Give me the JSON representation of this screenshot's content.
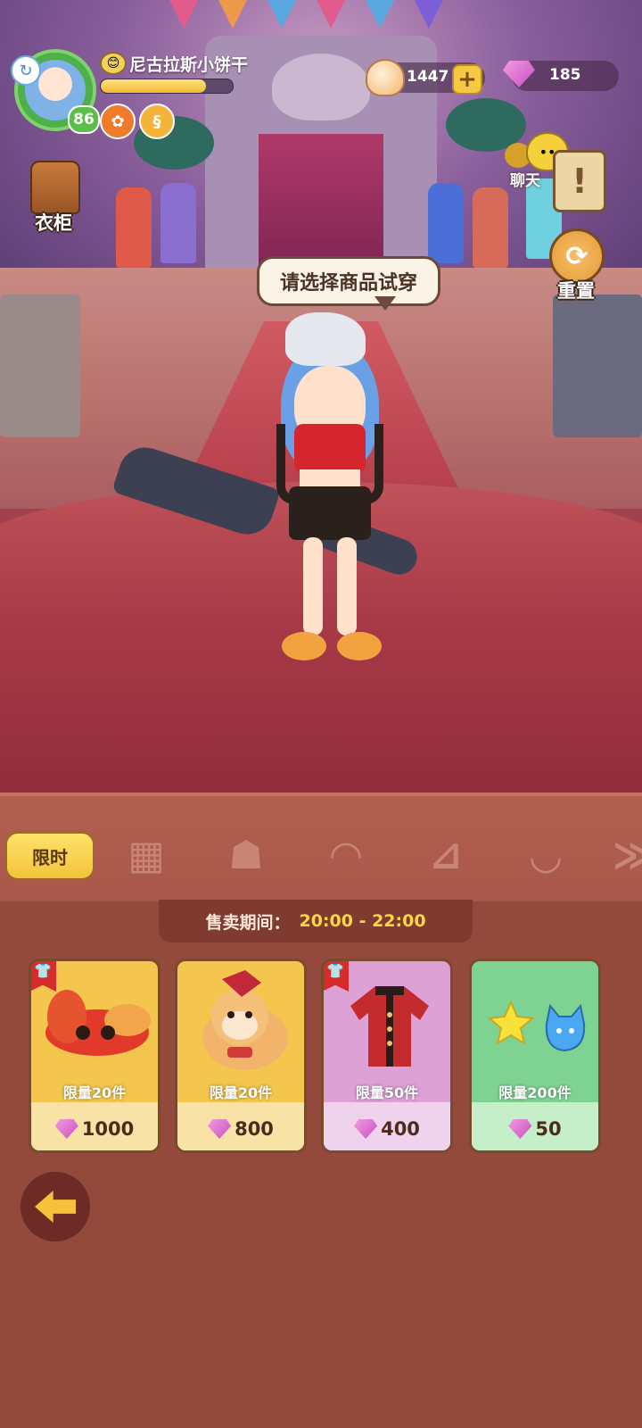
{
  "hud": {
    "player_name": "尼古拉斯小饼干",
    "level": "86",
    "exp_fraction": 0.8,
    "shells": "1447",
    "gems": "185"
  },
  "scene": {
    "prompt_bubble": "请选择商品试穿"
  },
  "side_buttons": {
    "wardrobe": "衣柜",
    "chat": "聊天",
    "reset": "重置"
  },
  "tabs": {
    "active_label": "限时",
    "icons": [
      "grid-icon",
      "face-icon",
      "hair-icon",
      "outfit-icon",
      "ears-icon",
      "more-icon"
    ]
  },
  "sale": {
    "label": "售卖期间：",
    "time": "20:00 - 22:00"
  },
  "items": [
    {
      "limit": "限量20件",
      "price": "1000",
      "tier": "gold",
      "tag": true,
      "icon": "mask-icon"
    },
    {
      "limit": "限量20件",
      "price": "800",
      "tier": "gold",
      "tag": false,
      "icon": "shiba-pet-icon"
    },
    {
      "limit": "限量50件",
      "price": "400",
      "tier": "purple",
      "tag": true,
      "icon": "jacket-icon"
    },
    {
      "limit": "限量200件",
      "price": "50",
      "tier": "green",
      "tag": false,
      "icon": "star-cat-icon"
    }
  ],
  "colors": {
    "panel_bg": "#93493c",
    "active_tab": "#f3c33b",
    "sale_time": "#ffd54a",
    "gold_card": "#f5c64d",
    "purple_card": "#dda1d6",
    "green_card": "#7fd392"
  }
}
